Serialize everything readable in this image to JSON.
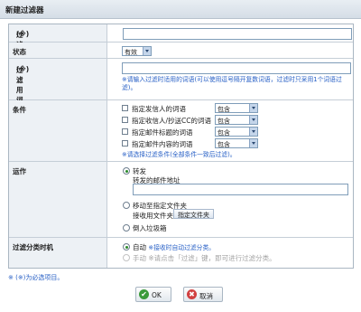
{
  "window": {
    "title": "新建过滤器"
  },
  "rows": {
    "name": {
      "label": "过滤器名",
      "req": "(※)",
      "value": ""
    },
    "status": {
      "label": "状态",
      "value": "有效"
    },
    "keywords": {
      "label": "过滤用词语",
      "req": "(※)",
      "value": "",
      "hint": "※请输入过滤时适用的词语(可以使用逗号隔开复数词语，过滤时只采用1个词语过滤)。"
    },
    "conditions": {
      "label": "条件",
      "items": [
        {
          "label": "指定发信人的词语",
          "select": "包含"
        },
        {
          "label": "指定收信人/抄送CC的词语",
          "select": "包含"
        },
        {
          "label": "指定邮件标题的词语",
          "select": "包含"
        },
        {
          "label": "指定邮件内容的词语",
          "select": "包含"
        }
      ],
      "hint": "※请选择过滤条件(全部条件一致后过滤)。"
    },
    "action": {
      "label": "运作",
      "forward": "转发",
      "forward_addr_label": "转发的邮件地址",
      "forward_addr_value": "",
      "move": "移动至指定文件夹",
      "folder_label": "接收用文件夹",
      "folder_button": "指定文件夹",
      "trash": "倒入垃圾箱"
    },
    "timing": {
      "label": "过滤分类时机",
      "auto": "自动",
      "auto_desc": "※接收时自动过滤分类。",
      "manual": "手动",
      "manual_desc": "※请点击「过滤」键，即可进行过滤分类。"
    }
  },
  "note": "※ (※)为必选项目。",
  "buttons": {
    "ok": "OK",
    "cancel": "取消"
  },
  "colors": {
    "accent": "#2860c6",
    "required": "#e00000",
    "label_bg": "#edf1f5"
  }
}
